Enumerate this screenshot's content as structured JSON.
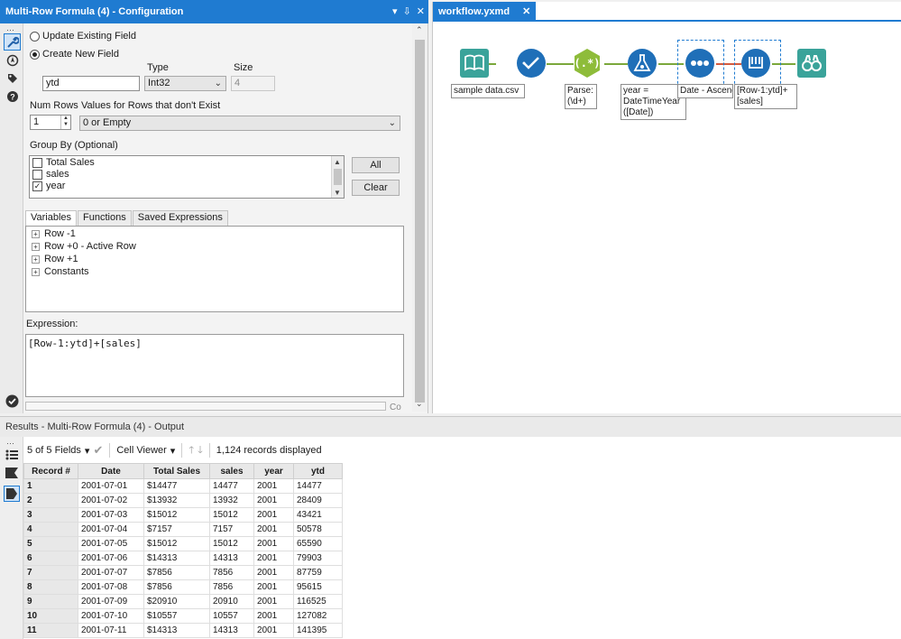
{
  "config": {
    "title": "Multi-Row Formula (4) - Configuration",
    "titlebar_buttons": {
      "menu": "▾",
      "pin": "⇩",
      "close": "✕"
    },
    "update_label": "Update Existing Field",
    "create_label": "Create New  Field",
    "type_label": "Type",
    "size_label": "Size",
    "field_name": "ytd",
    "type_value": "Int32",
    "size_value": "4",
    "num_rows_label": "Num Rows",
    "values_label": "Values for Rows that don't Exist",
    "num_rows_value": "1",
    "values_option": "0 or Empty",
    "group_by_label": "Group By (Optional)",
    "group_by_items": [
      {
        "label": "Total Sales",
        "checked": false
      },
      {
        "label": "sales",
        "checked": false
      },
      {
        "label": "year",
        "checked": true
      }
    ],
    "all_button": "All",
    "clear_button": "Clear",
    "tabs": [
      "Variables",
      "Functions",
      "Saved Expressions"
    ],
    "variables": [
      "Row -1",
      "Row +0 - Active Row",
      "Row +1",
      "Constants"
    ],
    "expression_label": "Expression:",
    "expression": "[Row-1:ytd]+[sales]",
    "truncated_label": "Co"
  },
  "workflow": {
    "tab_title": "workflow.yxmd",
    "tab_close": "✕",
    "tools": [
      {
        "name": "input",
        "label": "sample data.csv",
        "color": "#3aa39a"
      },
      {
        "name": "select",
        "label": "",
        "color": "#1f6fb8"
      },
      {
        "name": "regex",
        "label": "Parse:\n(\\d+)",
        "color": "#8ebc3a"
      },
      {
        "name": "formula",
        "label": "year =\nDateTimeYear\n([Date])",
        "color": "#1f6fb8"
      },
      {
        "name": "sort",
        "label": "Date - Ascend",
        "color": "#1f6fb8"
      },
      {
        "name": "multirow",
        "label": "[Row-1:ytd]+\n[sales]",
        "color": "#1f6fb8"
      },
      {
        "name": "browse",
        "label": "",
        "color": "#3aa39a"
      }
    ]
  },
  "results": {
    "title": "Results - Multi-Row Formula (4) - Output",
    "fields_label": "5 of 5 Fields",
    "viewer_label": "Cell Viewer",
    "records_label": "1,124 records displayed",
    "columns": [
      "Record #",
      "Date",
      "Total Sales",
      "sales",
      "year",
      "ytd"
    ],
    "rows": [
      [
        "1",
        "2001-07-01",
        "$14477",
        "14477",
        "2001",
        "14477"
      ],
      [
        "2",
        "2001-07-02",
        "$13932",
        "13932",
        "2001",
        "28409"
      ],
      [
        "3",
        "2001-07-03",
        "$15012",
        "15012",
        "2001",
        "43421"
      ],
      [
        "4",
        "2001-07-04",
        "$7157",
        "7157",
        "2001",
        "50578"
      ],
      [
        "5",
        "2001-07-05",
        "$15012",
        "15012",
        "2001",
        "65590"
      ],
      [
        "6",
        "2001-07-06",
        "$14313",
        "14313",
        "2001",
        "79903"
      ],
      [
        "7",
        "2001-07-07",
        "$7856",
        "7856",
        "2001",
        "87759"
      ],
      [
        "8",
        "2001-07-08",
        "$7856",
        "7856",
        "2001",
        "95615"
      ],
      [
        "9",
        "2001-07-09",
        "$20910",
        "20910",
        "2001",
        "116525"
      ],
      [
        "10",
        "2001-07-10",
        "$10557",
        "10557",
        "2001",
        "127082"
      ],
      [
        "11",
        "2001-07-11",
        "$14313",
        "14313",
        "2001",
        "141395"
      ]
    ]
  }
}
